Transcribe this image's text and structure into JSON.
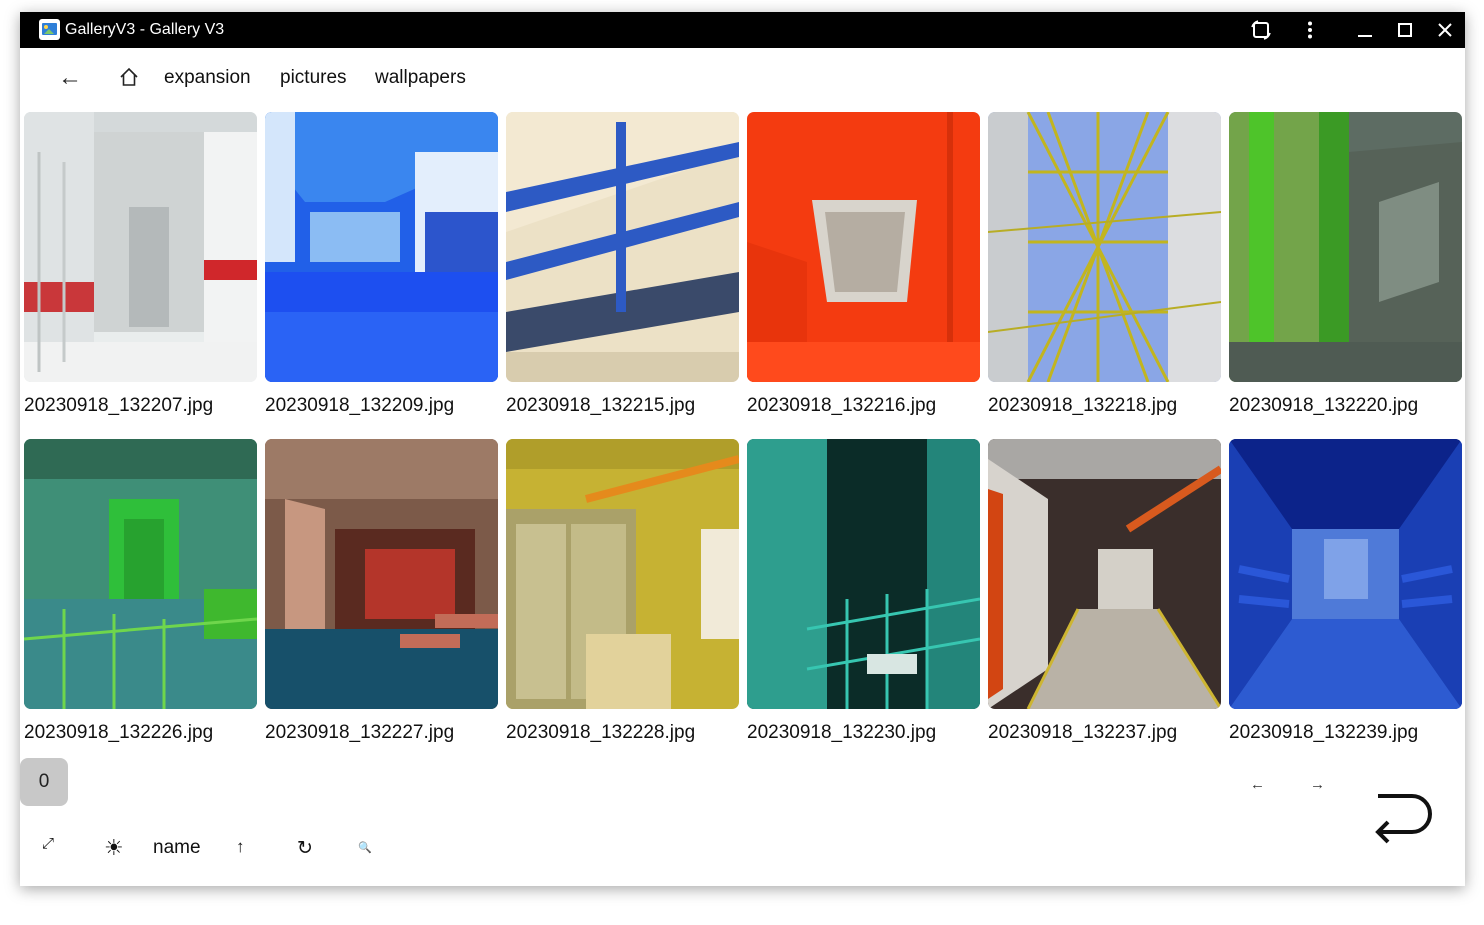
{
  "window": {
    "title": "GalleryV3 - Gallery V3",
    "controls": {
      "icons": [
        "app-gallery-icon",
        "rotate-screen-icon",
        "more-vert-icon",
        "minimize-icon",
        "maximize-icon",
        "close-icon"
      ]
    }
  },
  "nav": {
    "back_symbol": "←",
    "home_icon": "home-icon",
    "breadcrumbs": [
      "expansion",
      "pictures",
      "wallpapers"
    ]
  },
  "gallery": {
    "items": [
      {
        "name": "20230918_132207.jpg"
      },
      {
        "name": "20230918_132209.jpg"
      },
      {
        "name": "20230918_132215.jpg"
      },
      {
        "name": "20230918_132216.jpg"
      },
      {
        "name": "20230918_132218.jpg"
      },
      {
        "name": "20230918_132220.jpg"
      },
      {
        "name": "20230918_132226.jpg"
      },
      {
        "name": "20230918_132227.jpg"
      },
      {
        "name": "20230918_132228.jpg"
      },
      {
        "name": "20230918_132230.jpg"
      },
      {
        "name": "20230918_132237.jpg"
      },
      {
        "name": "20230918_132239.jpg"
      }
    ]
  },
  "footer": {
    "selected_count": "0",
    "prev_symbol": "←",
    "next_symbol": "→",
    "expand_symbol": "⤢",
    "theme_symbol": "☀",
    "sort_field": "name",
    "sort_direction_symbol": "↑",
    "refresh_symbol": "↻",
    "search_symbol": "🔍",
    "return_icon": "return-icon"
  },
  "colors": {
    "titlebar": "#000000",
    "background": "#ffffff",
    "badge": "#c8c8c8"
  }
}
